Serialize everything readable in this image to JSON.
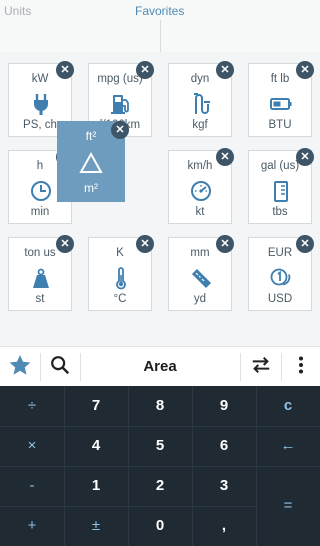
{
  "tabs": {
    "units": "Units",
    "favorites": "Favorites"
  },
  "tiles": [
    {
      "top": "kW",
      "bottom": "PS, ch",
      "icon": "plug-icon"
    },
    {
      "top": "mpg (us)",
      "bottom": "l/100km",
      "icon": "fuel-pump-icon"
    },
    {
      "top": "dyn",
      "bottom": "kgf",
      "icon": "spring-icon"
    },
    {
      "top": "ft lb",
      "bottom": "BTU",
      "icon": "battery-icon"
    },
    {
      "top": "h",
      "bottom": "min",
      "icon": "clock-icon"
    },
    {
      "top": "km/h",
      "bottom": "kt",
      "icon": "speedometer-icon"
    },
    {
      "top": "gal (us)",
      "bottom": "tbs",
      "icon": "measuring-cup-icon"
    },
    {
      "top": "ton us",
      "bottom": "st",
      "icon": "weight-icon"
    },
    {
      "top": "K",
      "bottom": "°C",
      "icon": "thermometer-icon"
    },
    {
      "top": "mm",
      "bottom": "yd",
      "icon": "ruler-icon"
    },
    {
      "top": "EUR",
      "bottom": "USD",
      "icon": "coins-icon"
    }
  ],
  "dragging_tile": {
    "top": "ft²",
    "bottom": "m²",
    "icon": "triangle-icon"
  },
  "toolbar": {
    "title": "Area"
  },
  "keypad": {
    "rows": [
      [
        "÷",
        "7",
        "8",
        "9",
        "c"
      ],
      [
        "×",
        "4",
        "5",
        "6",
        "←"
      ],
      [
        "-",
        "1",
        "2",
        "3",
        "="
      ],
      [
        "+",
        "±",
        "0",
        ",",
        ""
      ]
    ]
  },
  "colors": {
    "accent": "#4f8ab4",
    "icon": "#3f7fb0",
    "close_badge": "#3d5567",
    "keypad_bg": "#1f2a33",
    "drag_tile": "#6d9cbe"
  }
}
